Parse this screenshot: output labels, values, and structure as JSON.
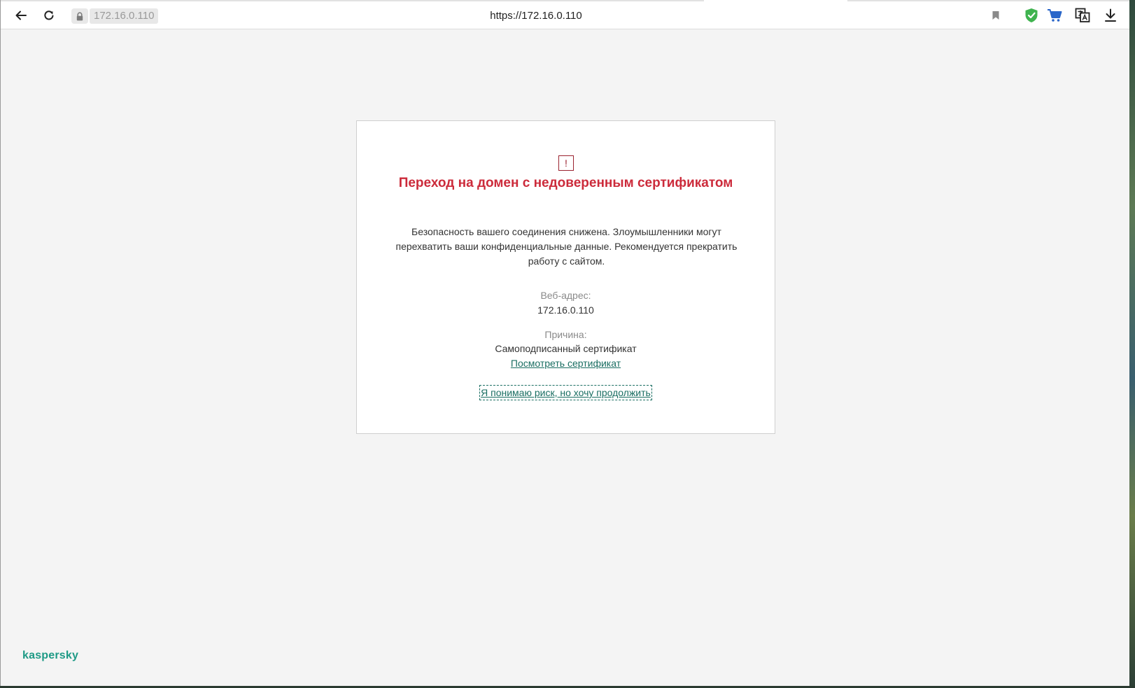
{
  "browser": {
    "address_host": "172.16.0.110",
    "address_url": "https://172.16.0.110",
    "icons": {
      "back": "back-arrow-icon",
      "reload": "reload-icon",
      "lock": "lock-icon",
      "bookmark": "bookmark-icon",
      "shield": "kaspersky-shield-icon",
      "cart": "cart-icon",
      "translate": "translate-icon",
      "download": "download-icon"
    }
  },
  "warning": {
    "icon_glyph": "!",
    "title": "Переход на домен с недоверенным сертификатом",
    "description": "Безопасность вашего соединения снижена. Злоумышленники могут перехватить ваши конфиденциальные данные. Рекомендуется прекратить работу с сайтом.",
    "web_address_label": "Веб-адрес:",
    "web_address_value": "172.16.0.110",
    "reason_label": "Причина:",
    "reason_value": "Самоподписанный сертификат",
    "view_certificate_link": "Посмотреть сертификат",
    "proceed_link": "Я понимаю риск, но хочу продолжить"
  },
  "footer": {
    "brand": "kaspersky"
  },
  "colors": {
    "title_red": "#cc2b3b",
    "link_green": "#1a6e62",
    "brand_teal": "#1e9a86",
    "shield_green": "#3fb34f",
    "cart_blue": "#2a66c9"
  }
}
